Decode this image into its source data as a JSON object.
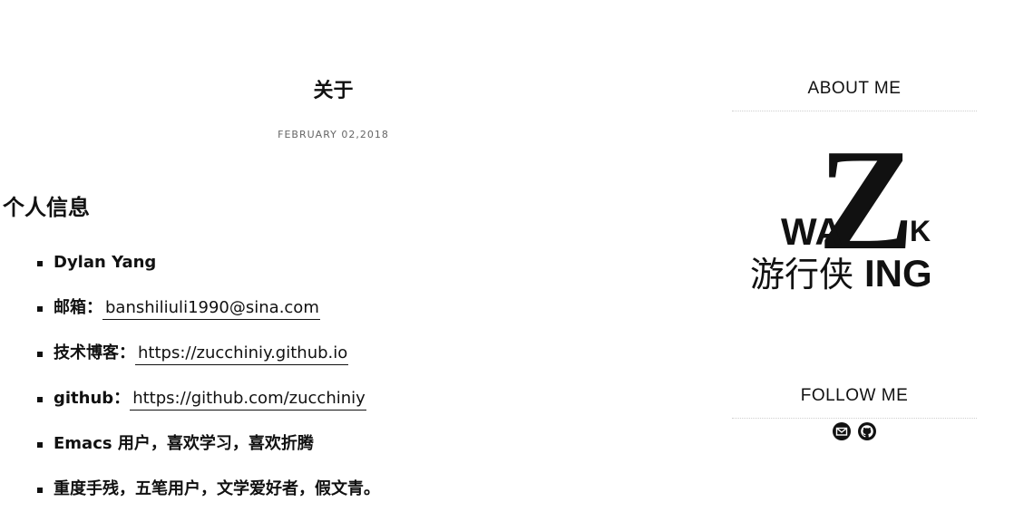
{
  "post": {
    "title": "关于",
    "date": "FEBRUARY 02,2018",
    "section_heading": "个人信息",
    "items": [
      {
        "prefix": "Dylan Yang",
        "link": ""
      },
      {
        "prefix": "邮箱：",
        "link": "banshiliuli1990@sina.com"
      },
      {
        "prefix": "技术博客：",
        "link": "https://zucchiniy.github.io"
      },
      {
        "prefix": "github：",
        "link": "https://github.com/zucchiniy"
      },
      {
        "prefix": "Emacs 用户，喜欢学习，喜欢折腾",
        "link": ""
      },
      {
        "prefix": "重度手残，五笔用户，文学爱好者，假文青。",
        "link": ""
      }
    ]
  },
  "sidebar": {
    "about_title": "ABOUT ME",
    "logo": {
      "big_letter": "Z",
      "left_letters": "WA",
      "right_letter": "K",
      "chinese": "游行侠",
      "suffix": "ING"
    },
    "follow_title": "FOLLOW ME",
    "social_icons": [
      "mail-icon",
      "github-icon"
    ]
  }
}
